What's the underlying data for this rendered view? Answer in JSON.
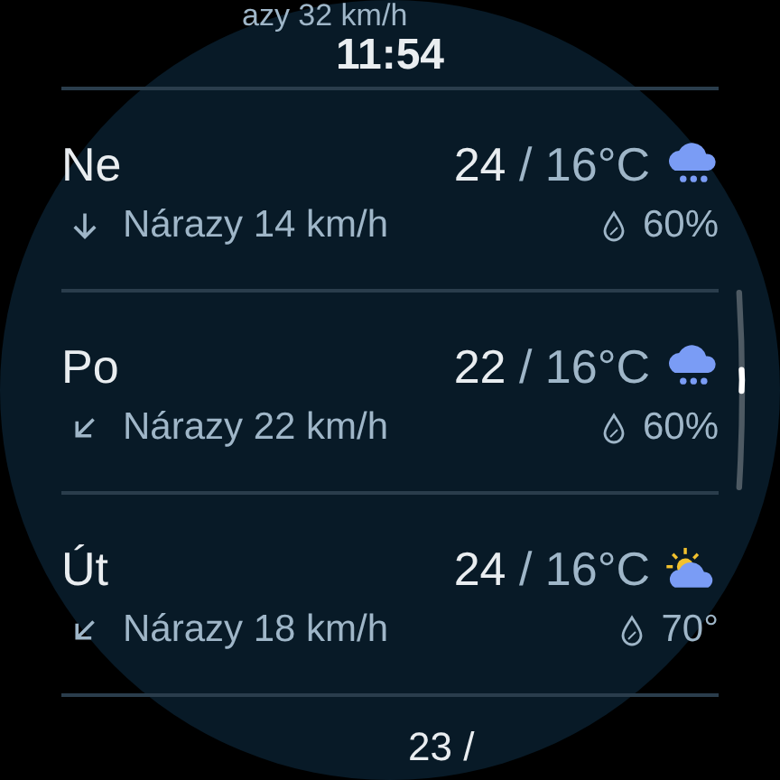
{
  "status_bar": {
    "time": "11:54"
  },
  "top_partial": {
    "gusts": "azy 32 km/h"
  },
  "days": [
    {
      "day": "Ne",
      "high": "24",
      "low": " / 16°C",
      "weather_icon": {
        "kind": "rain"
      },
      "wind_icon": {
        "kind": "s"
      },
      "gusts": "Nárazy 14 km/h",
      "humidity": "60%"
    },
    {
      "day": "Po",
      "high": "22",
      "low": " / 16°C",
      "weather_icon": {
        "kind": "rain"
      },
      "wind_icon": {
        "kind": "sw"
      },
      "gusts": "Nárazy 22 km/h",
      "humidity": "60%"
    },
    {
      "day": "Út",
      "high": "24",
      "low": " / 16°C",
      "weather_icon": {
        "kind": "partly_cloudy"
      },
      "wind_icon": {
        "kind": "sw"
      },
      "gusts": "Nárazy 18 km/h",
      "humidity": "70°"
    }
  ],
  "bottom_partial": {
    "high": "23 /"
  }
}
